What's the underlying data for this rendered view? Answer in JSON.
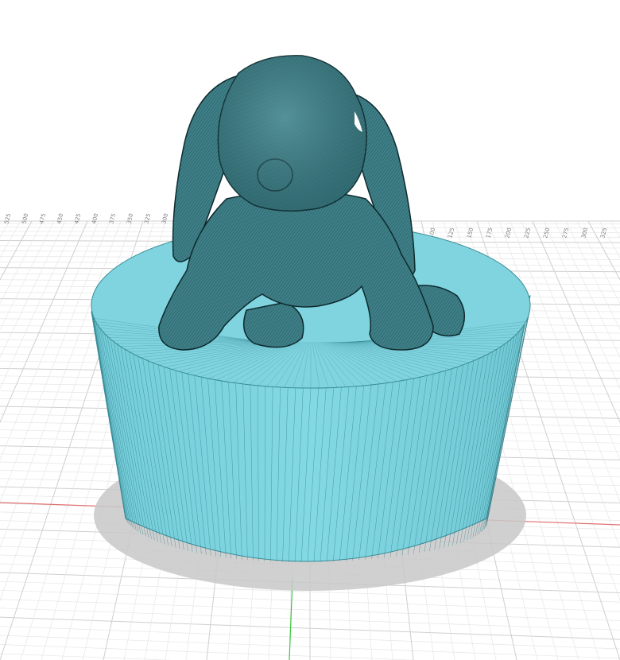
{
  "viewport": {
    "name": "3D modeling workspace - bunny on pedestal",
    "colors": {
      "background": "#ffffff",
      "grid_minor": "#e6e6e6",
      "grid_major": "#cfcfcf",
      "x_axis": "#e07070",
      "y_axis": "#3cc83c",
      "pedestal": "#7ed4df",
      "pedestal_facet": "#2f7f8a",
      "bunny_mesh": "#3f8088",
      "shadow": "#c8c8c8"
    },
    "ruler_top": {
      "left_labels": [
        "525",
        "500",
        "475",
        "450",
        "425",
        "400",
        "375",
        "350",
        "325",
        "300"
      ],
      "right_labels": [
        "75",
        "100",
        "125",
        "150",
        "175",
        "200",
        "225",
        "250",
        "275",
        "300",
        "325"
      ]
    }
  }
}
